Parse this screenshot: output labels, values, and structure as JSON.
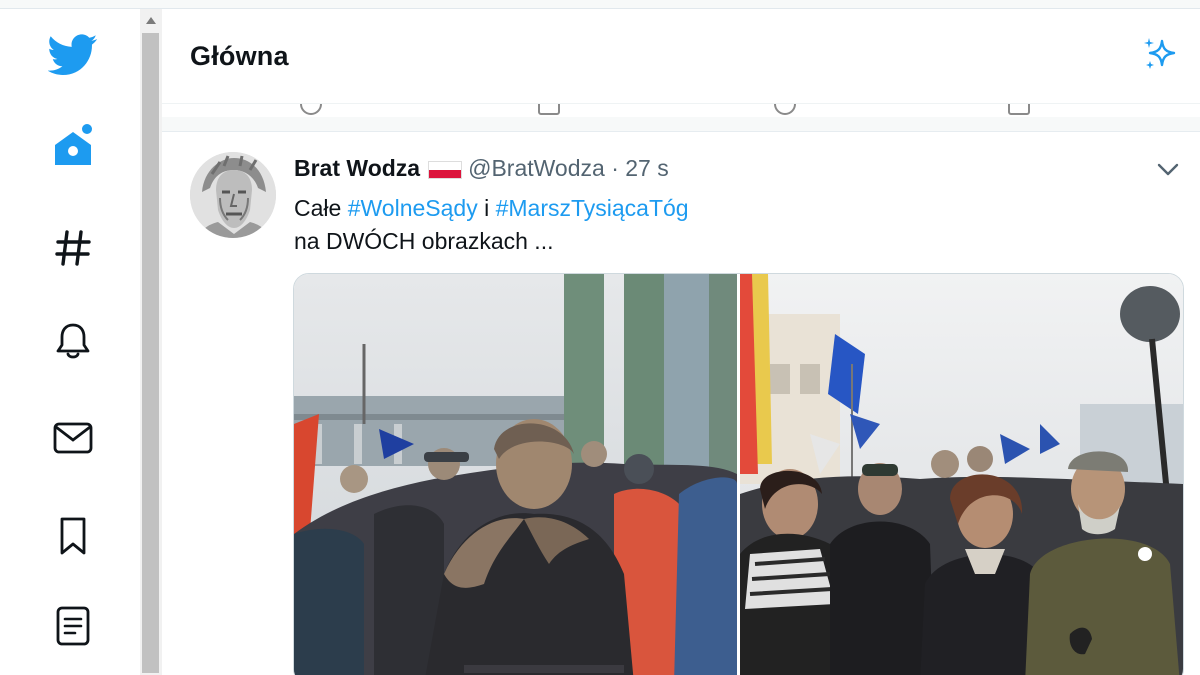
{
  "header": {
    "title": "Główna"
  },
  "tweet": {
    "name": "Brat Wodza",
    "handle": "@BratWodza",
    "separator": "·",
    "time": "27 s",
    "text_start": "Całe ",
    "hashtag1": "#WolneSądy",
    "text_mid": " i ",
    "hashtag2": "#MarszTysiącaTóg",
    "line2": "na DWÓCH obrazkach ..."
  },
  "icons": {
    "nav": [
      "twitter-logo-icon",
      "home-icon",
      "explore-hashtag-icon",
      "notifications-bell-icon",
      "messages-envelope-icon",
      "bookmarks-icon",
      "lists-icon"
    ],
    "header": "sparkle-icon",
    "tweet_menu": "chevron-down-icon"
  },
  "colors": {
    "accent": "#1d9bf0",
    "text": "#0f1419",
    "secondary_text": "#536471"
  }
}
